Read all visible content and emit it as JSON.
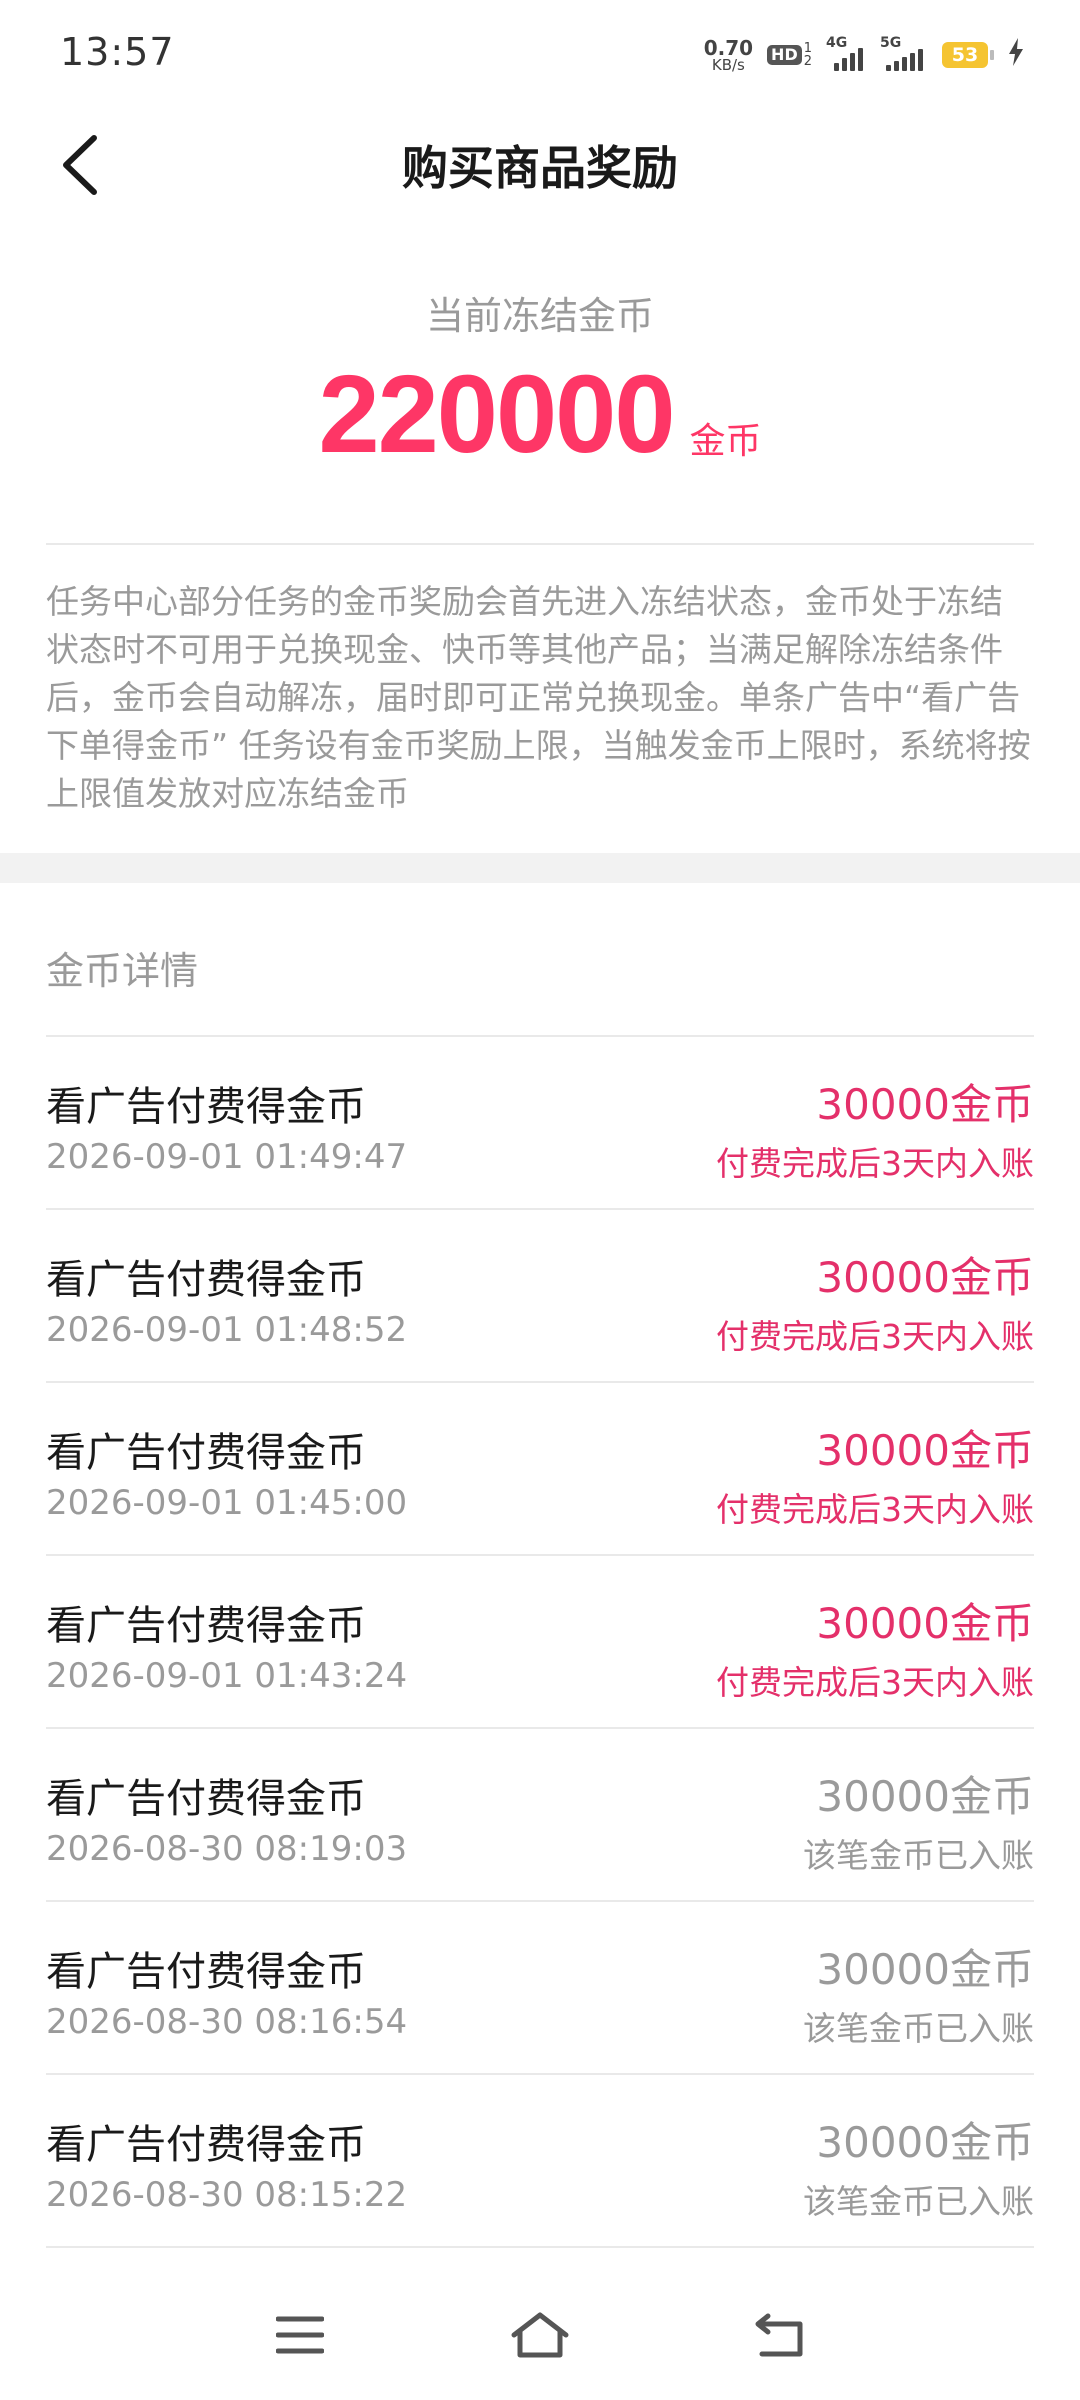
{
  "status_bar": {
    "time": "13:57",
    "net_speed_value": "0.70",
    "net_speed_unit": "KB/s",
    "hd_label": "HD",
    "hd_num_top": "1",
    "hd_num_bottom": "2",
    "signal_1": "4G",
    "signal_2": "5G",
    "battery": "53"
  },
  "header": {
    "title": "购买商品奖励"
  },
  "summary": {
    "label": "当前冻结金币",
    "amount": "220000",
    "unit": "金币"
  },
  "notice": "任务中心部分任务的金币奖励会首先进入冻结状态，金币处于冻结状态时不可用于兑换现金、快币等其他产品；当满足解除冻结条件后，金币会自动解冻，届时即可正常兑换现金。单条广告中“看广告下单得金币” 任务设有金币奖励上限，当触发金币上限时，系统将按上限值发放对应冻结金币",
  "details": {
    "title": "金币详情",
    "rows": [
      {
        "name": "看广告付费得金币",
        "time": "2026-09-01 01:49:47",
        "amount": "30000金币",
        "status": "付费完成后3天内入账"
      },
      {
        "name": "看广告付费得金币",
        "time": "2026-09-01 01:48:52",
        "amount": "30000金币",
        "status": "付费完成后3天内入账"
      },
      {
        "name": "看广告付费得金币",
        "time": "2026-09-01 01:45:00",
        "amount": "30000金币",
        "status": "付费完成后3天内入账"
      },
      {
        "name": "看广告付费得金币",
        "time": "2026-09-01 01:43:24",
        "amount": "30000金币",
        "status": "付费完成后3天内入账"
      },
      {
        "name": "看广告付费得金币",
        "time": "2026-08-30 08:19:03",
        "amount": "30000金币",
        "status": "该笔金币已入账"
      },
      {
        "name": "看广告付费得金币",
        "time": "2026-08-30 08:16:54",
        "amount": "30000金币",
        "status": "该笔金币已入账"
      },
      {
        "name": "看广告付费得金币",
        "time": "2026-08-30 08:15:22",
        "amount": "30000金币",
        "status": "该笔金币已入账"
      }
    ]
  },
  "colors": {
    "accent": "#fe3666",
    "pending_text": "#e4306a",
    "muted_text": "#9a9a9a"
  }
}
